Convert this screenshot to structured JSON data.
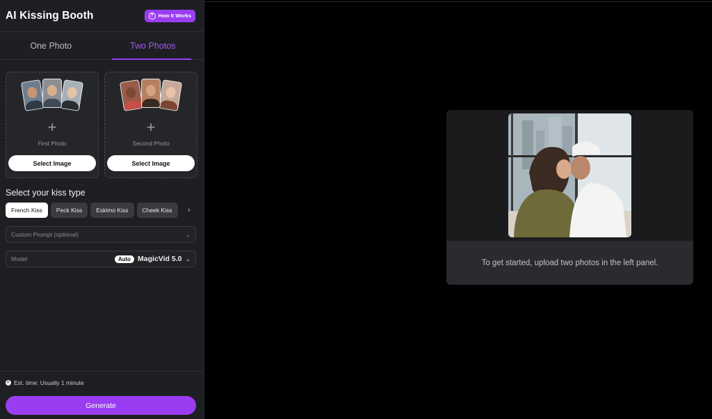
{
  "app": {
    "title": "AI Kissing Booth",
    "how_it_works": "How It Works"
  },
  "tabs": [
    {
      "label": "One Photo",
      "active": false
    },
    {
      "label": "Two Photos",
      "active": true
    }
  ],
  "uploads": [
    {
      "label": "First Photo",
      "button": "Select Image"
    },
    {
      "label": "Second Photo",
      "button": "Select Image"
    }
  ],
  "kiss_type": {
    "title": "Select your kiss type",
    "options": [
      "French Kiss",
      "Peck Kiss",
      "Eskimo Kiss",
      "Cheek Kiss"
    ],
    "selected": "French Kiss"
  },
  "custom_prompt": {
    "placeholder": "Custom Prompt (optional)"
  },
  "model": {
    "label": "Model",
    "badge": "Auto",
    "value": "MagicVid 5.0"
  },
  "footer": {
    "est_time": "Est. time: Usually 1 minute",
    "generate": "Generate"
  },
  "preview": {
    "message": "To get started, upload two photos in the left panel."
  },
  "colors": {
    "accent": "#9a3df2",
    "panel_bg": "#1e1f22",
    "page_bg": "#000000"
  }
}
